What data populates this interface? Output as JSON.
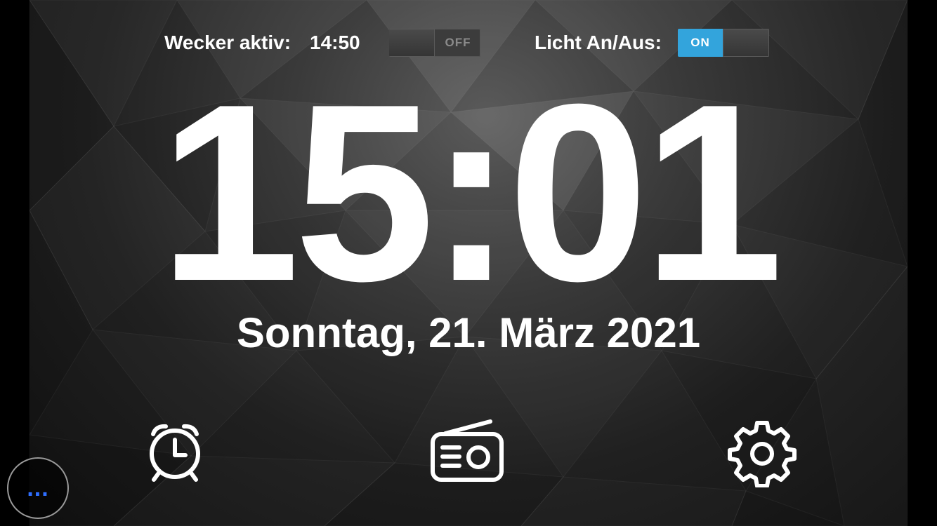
{
  "header": {
    "alarm_label": "Wecker aktiv:",
    "alarm_time": "14:50",
    "alarm_toggle_state": "OFF",
    "light_label": "Licht An/Aus:",
    "light_toggle_state": "ON"
  },
  "clock": {
    "time": "15:01",
    "date": "Sonntag, 21. März 2021"
  },
  "nav": {
    "items": [
      {
        "icon": "alarm-clock-icon"
      },
      {
        "icon": "radio-icon"
      },
      {
        "icon": "gear-icon"
      }
    ]
  },
  "menu": {
    "dots": "...",
    "icon": "more-dots-icon"
  },
  "colors": {
    "accent_on": "#33a4dc",
    "menu_dots": "#2f6fff",
    "text": "#ffffff"
  }
}
